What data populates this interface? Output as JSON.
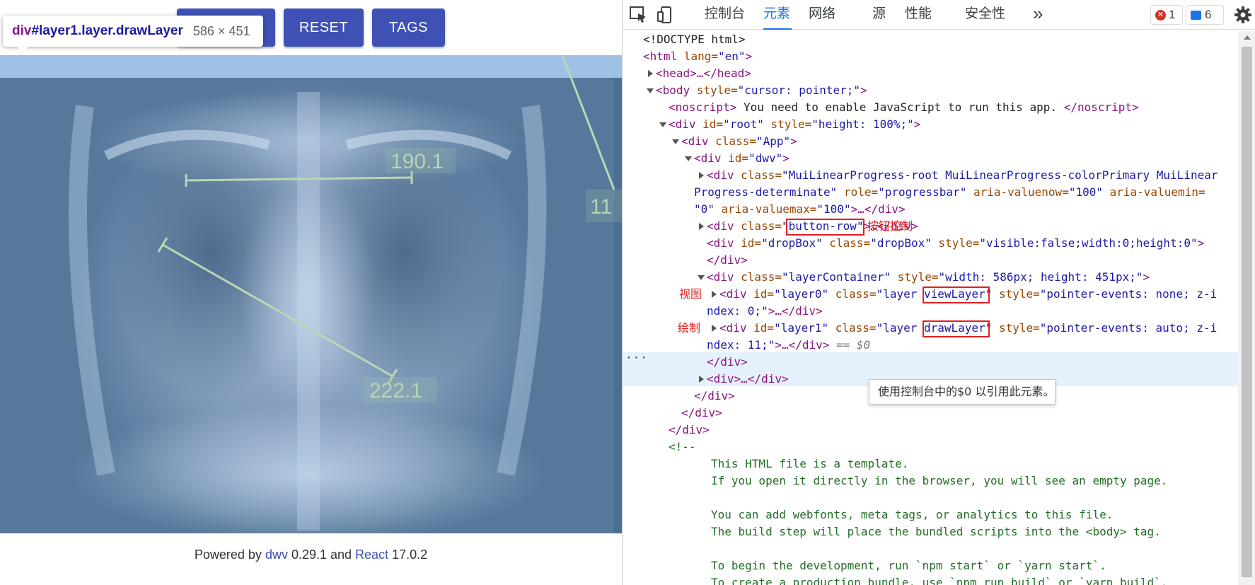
{
  "app": {
    "buttons": {
      "reset": "RESET",
      "tags": "TAGS"
    },
    "hover_tooltip": {
      "selector_tag": "div",
      "selector_rest": "#layer1.layer.drawLayer",
      "size": "586 × 451"
    },
    "measurements": [
      {
        "label": "190.1"
      },
      {
        "label": "222.1"
      },
      {
        "label": "11"
      }
    ],
    "footer": {
      "prefix": "Powered by ",
      "dwv_link": "dwv",
      "dwv_version": " 0.29.1 and ",
      "react_link": "React",
      "react_version": " 17.0.2"
    }
  },
  "devtools": {
    "tabs": [
      "控制台",
      "元素",
      "网络",
      "源",
      "性能",
      "安全性"
    ],
    "active_tab": "元素",
    "more": "»",
    "error_count": "1",
    "message_count": "6",
    "dom": {
      "doctype": "<!DOCTYPE html>",
      "html_open": {
        "tag": "<html",
        "attr": " lang=",
        "val": "\"en\"",
        "end": ">"
      },
      "head": "<head>…</head>",
      "body_open": {
        "tag": "<body",
        "attr": " style=",
        "val": "\"cursor: pointer;\"",
        "end": ">"
      },
      "noscript": {
        "open": "<noscript>",
        "text": " You need to enable JavaScript to run this app. ",
        "close": "</noscript>"
      },
      "root_div": {
        "tag": "<div",
        "attr1": " id=",
        "val1": "\"root\"",
        "attr2": " style=",
        "val2": "\"height: 100%;\"",
        "end": ">"
      },
      "app_div": {
        "tag": "<div",
        "attr": " class=",
        "val": "\"App\"",
        "end": ">"
      },
      "dwv_div": {
        "tag": "<div",
        "attr": " id=",
        "val": "\"dwv\"",
        "end": ">"
      },
      "progress": {
        "line1_tag": "<div",
        "line1_attr": " class=",
        "line1_val": "\"MuiLinearProgress-root MuiLinearProgress-colorPrimary MuiLinear",
        "line2_val": "Progress-determinate\"",
        "line2_attr1": " role=",
        "line2_val1": "\"progressbar\"",
        "line2_attr2": " aria-valuenow=",
        "line2_val2": "\"100\"",
        "line2_attr3": " aria-valuemin=",
        "line3_val3": "\"0\"",
        "line3_attr4": " aria-valuemax=",
        "line3_val4": "\"100\"",
        "line3_end": ">…</div>"
      },
      "button_row": {
        "tag": "<div",
        "attr": " class=",
        "val_q": "\"",
        "val": "button-row",
        "val_q2": "\"",
        "end": ">…</div>"
      },
      "dropbox": {
        "tag": "<div",
        "attr1": " id=",
        "val1": "\"dropBox\"",
        "attr2": " class=",
        "val2": "\"dropBox\"",
        "attr3": " style=",
        "val3": "\"visible:false;width:0;height:0\"",
        "end": ">"
      },
      "close_div": "</div>",
      "layer_container": {
        "tag": "<div",
        "attr1": " class=",
        "val1": "\"layerContainer\"",
        "attr2": " style=",
        "val2": "\"width: 586px; height: 451px;\"",
        "end": ">"
      },
      "layer0": {
        "tag": "<div",
        "attr1": " id=",
        "val1": "\"layer0\"",
        "attr2": " class=",
        "val2a": "\"layer ",
        "val2b": "viewLayer",
        "val2c": "\"",
        "attr3": " style=",
        "val3": "\"pointer-events: none; z-i",
        "line2": "ndex: 0;\"",
        "line2_end": ">…</div>"
      },
      "layer1": {
        "tag": "<div",
        "attr1": " id=",
        "val1": "\"layer1\"",
        "attr2": " class=",
        "val2a": "\"layer ",
        "val2b": "drawLayer",
        "val2c": "\"",
        "attr3": " style=",
        "val3": "\"pointer-events: auto; z-i",
        "line2": "ndex: 11;\"",
        "line2_end": ">…</div>",
        "ref": " == $0"
      },
      "div_collapsed": "<div>…</div>",
      "comment_open": "<!--",
      "comment_lines": [
        "This HTML file is a template.",
        "If you open it directly in the browser, you will see an empty page.",
        "",
        "You can add webfonts, meta tags, or analytics to this file.",
        "The build step will place the bundled scripts into the <body> tag.",
        "",
        "To begin the development, run `npm start` or `yarn start`.",
        "To create a production bundle, use `npm run build` or `yarn build`."
      ]
    },
    "annotations": {
      "button_row": "按钮控制",
      "view_layer": "视图",
      "draw_layer": "绘制"
    },
    "ellipsis": "···",
    "tooltip": "使用控制台中的$0 以引用此元素。"
  }
}
